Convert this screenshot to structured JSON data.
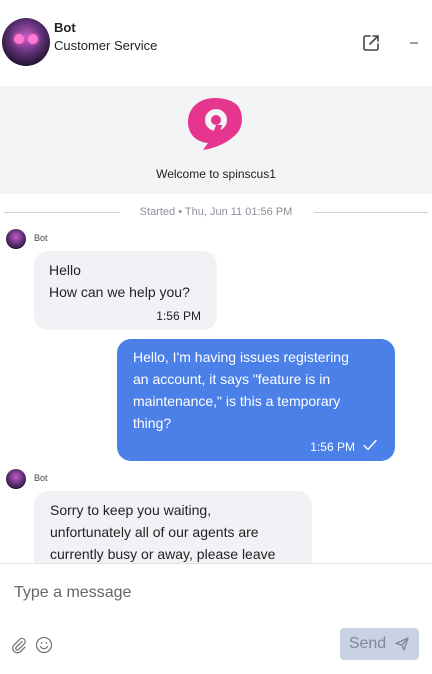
{
  "header": {
    "bot_name": "Bot",
    "subtitle": "Customer Service"
  },
  "welcome": {
    "text": "Welcome to spinscus1",
    "accent": "#e5358f"
  },
  "conversation": {
    "started_label": "Started • Thu, Jun 11 01:56 PM",
    "messages": [
      {
        "sender": "Bot",
        "direction": "incoming",
        "lines": [
          "Hello",
          "How can we help you?"
        ],
        "time": "1:56 PM"
      },
      {
        "direction": "outgoing",
        "lines": [
          "Hello, I'm having issues registering",
          "an account, it says \"feature is in",
          "maintenance,\" is this a temporary",
          "thing?"
        ],
        "time": "1:56 PM",
        "status_icon": "check-icon"
      },
      {
        "sender": "Bot",
        "direction": "incoming",
        "lines": [
          "Sorry to keep you waiting,",
          "unfortunately all of our agents are",
          "currently busy or away, please leave"
        ]
      }
    ]
  },
  "composer": {
    "placeholder": "Type a message",
    "send_label": "Send"
  },
  "colors": {
    "outgoing_bubble": "#4a80e8",
    "incoming_bubble": "#f1f2f6",
    "send_button": "#c9d2e3"
  }
}
